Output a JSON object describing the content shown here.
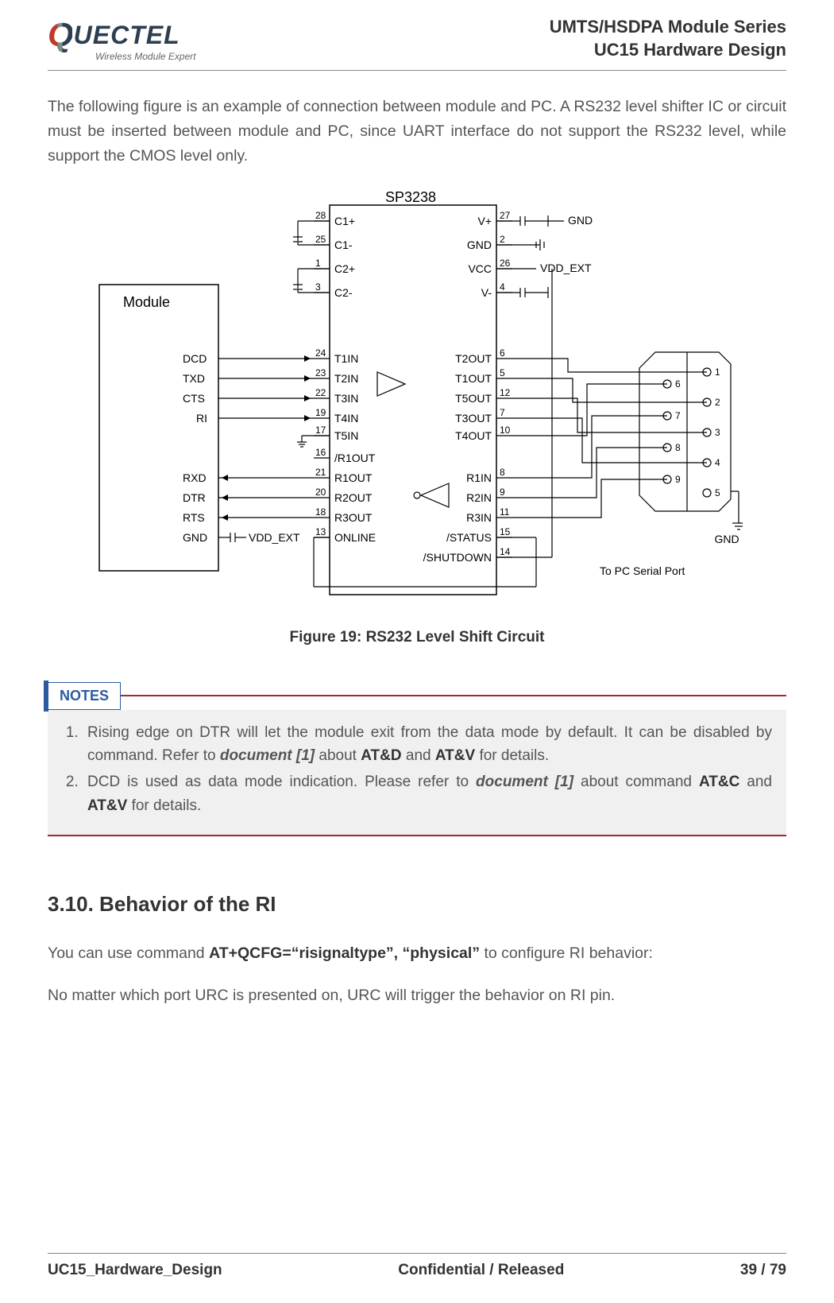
{
  "header": {
    "logo_main": "UECTEL",
    "logo_sub": "Wireless Module Expert",
    "right1": "UMTS/HSDPA Module Series",
    "right2": "UC15 Hardware Design"
  },
  "intro": "The following figure is an example of connection between module and PC. A RS232 level shifter IC or circuit must be inserted between module and PC, since UART interface do not support the RS232 level, while support the CMOS level only.",
  "figure": {
    "caption": "Figure 19: RS232 Level Shift Circuit",
    "module_label": "Module",
    "chip_label": "SP3238",
    "module_pins": [
      "DCD",
      "TXD",
      "CTS",
      "RI",
      "RXD",
      "DTR",
      "RTS",
      "GND"
    ],
    "module_vdd": "VDD_EXT",
    "left_pin_nums": [
      "28",
      "25",
      "1",
      "3",
      "24",
      "23",
      "22",
      "19",
      "17",
      "16",
      "21",
      "20",
      "18",
      "13"
    ],
    "left_pin_names": [
      "C1+",
      "C1-",
      "C2+",
      "C2-",
      "T1IN",
      "T2IN",
      "T3IN",
      "T4IN",
      "T5IN",
      "/R1OUT",
      "R1OUT",
      "R2OUT",
      "R3OUT",
      "ONLINE"
    ],
    "right_pin_names": [
      "V+",
      "GND",
      "VCC",
      "V-",
      "T2OUT",
      "T1OUT",
      "T5OUT",
      "T3OUT",
      "T4OUT",
      "R1IN",
      "R2IN",
      "R3IN",
      "/STATUS",
      "/SHUTDOWN"
    ],
    "right_pin_nums": [
      "27",
      "2",
      "26",
      "4",
      "6",
      "5",
      "12",
      "7",
      "10",
      "8",
      "9",
      "11",
      "15",
      "14"
    ],
    "ext_labels": {
      "gnd": "GND",
      "vdd": "VDD_EXT",
      "to_pc": "To PC Serial Port",
      "conn_gnd": "GND"
    },
    "db9_left_nums": [
      "6",
      "7",
      "8",
      "9"
    ],
    "db9_right_nums": [
      "1",
      "2",
      "3",
      "4",
      "5"
    ]
  },
  "notes": {
    "title": "NOTES",
    "items": [
      {
        "pre": "Rising edge on DTR will let the module exit from the data mode by default. It can be disabled by command. Refer to ",
        "doc": "document [1]",
        "mid": " about ",
        "b1": "AT&D",
        "and": " and ",
        "b2": "AT&V",
        "post": " for details."
      },
      {
        "pre": "DCD is used as data mode indication. Please refer to ",
        "doc": "document [1]",
        "mid": " about command ",
        "b1": "AT&C",
        "and": " and ",
        "b2": "AT&V",
        "post": " for details."
      }
    ]
  },
  "section": {
    "title": "3.10. Behavior of the RI",
    "p1a": "You can use command ",
    "p1b": "AT+QCFG=“risignaltype”, “physical”",
    "p1c": " to configure RI behavior:",
    "p2": "No matter which port URC is presented on, URC will trigger the behavior on RI pin."
  },
  "footer": {
    "left": "UC15_Hardware_Design",
    "center": "Confidential / Released",
    "right": "39 / 79"
  }
}
